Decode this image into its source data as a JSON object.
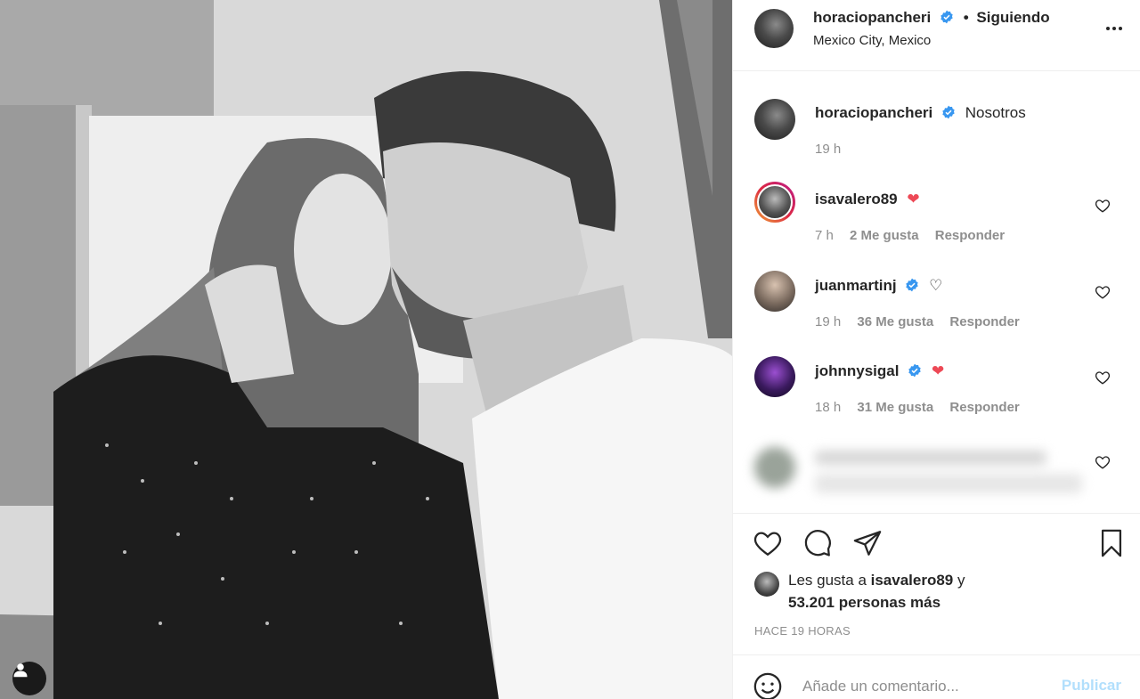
{
  "photo": {
    "alt_icon": "person-tag-icon"
  },
  "header": {
    "username": "horaciopancheri",
    "dot": "•",
    "follow_label": "Siguiendo",
    "location": "Mexico City, Mexico",
    "more_icon": "ellipsis-icon"
  },
  "caption": {
    "username": "horaciopancheri",
    "text": "Nosotros",
    "time": "19 h"
  },
  "comments": [
    {
      "username": "isavalero89",
      "emoji": "❤",
      "time": "7 h",
      "likes": "2 Me gusta",
      "reply": "Responder"
    },
    {
      "username": "juanmartinj",
      "emoji": "♡",
      "time": "19 h",
      "likes": "36 Me gusta",
      "reply": "Responder"
    },
    {
      "username": "johnnysigal",
      "emoji": "❤",
      "time": "18 h",
      "likes": "31 Me gusta",
      "reply": "Responder"
    }
  ],
  "likes": {
    "prefix": "Les gusta a ",
    "user": "isavalero89",
    "mid": " y",
    "count": "53.201 personas más"
  },
  "posted": "HACE 19 HORAS",
  "add_comment": {
    "placeholder": "Añade un comentario...",
    "publish": "Publicar"
  },
  "colors": {
    "verified": "#3897f0",
    "heart": "#ed4956",
    "publish_disabled": "#b2dffc",
    "meta": "#8e8e8e"
  }
}
